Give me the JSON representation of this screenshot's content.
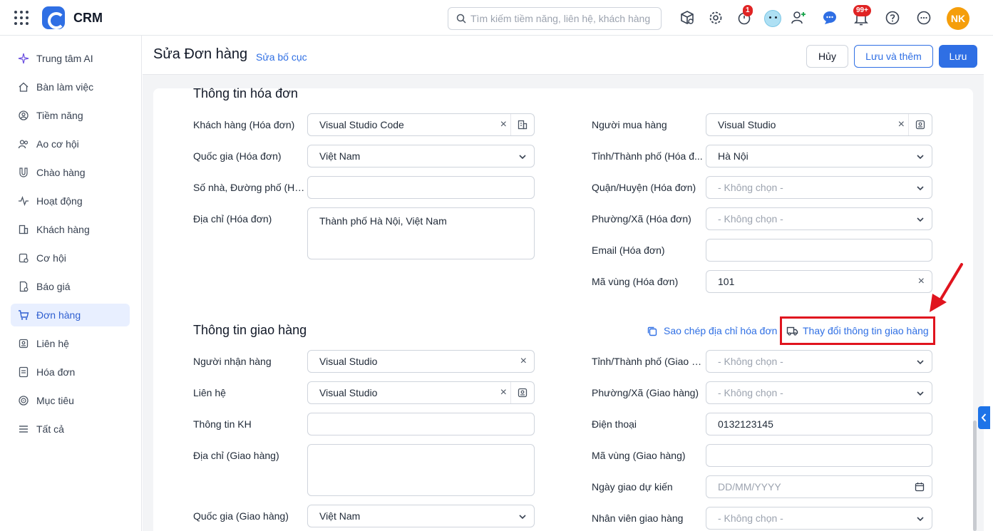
{
  "app": {
    "name": "CRM"
  },
  "search": {
    "placeholder": "Tìm kiếm tiềm năng, liên hệ, khách hàng"
  },
  "topbar": {
    "badge_timer": "1",
    "badge_bell": "99+",
    "avatar_initials": "NK"
  },
  "sidebar": {
    "items": [
      {
        "label": "Trung tâm AI",
        "icon": "sparkle-icon"
      },
      {
        "label": "Bàn làm việc",
        "icon": "home-icon"
      },
      {
        "label": "Tiềm năng",
        "icon": "target-user-icon"
      },
      {
        "label": "Ao cơ hội",
        "icon": "users-icon"
      },
      {
        "label": "Chào hàng",
        "icon": "magnet-icon"
      },
      {
        "label": "Hoạt động",
        "icon": "activity-icon"
      },
      {
        "label": "Khách hàng",
        "icon": "building-icon"
      },
      {
        "label": "Cơ hội",
        "icon": "opportunity-icon"
      },
      {
        "label": "Báo giá",
        "icon": "quote-icon"
      },
      {
        "label": "Đơn hàng",
        "icon": "cart-icon"
      },
      {
        "label": "Liên hệ",
        "icon": "contact-icon"
      },
      {
        "label": "Hóa đơn",
        "icon": "invoice-icon"
      },
      {
        "label": "Mục tiêu",
        "icon": "goal-icon"
      },
      {
        "label": "Tất cả",
        "icon": "menu-icon"
      }
    ],
    "active_index": 9
  },
  "page": {
    "title": "Sửa Đơn hàng",
    "edit_layout": "Sửa bố cục"
  },
  "actions": {
    "cancel": "Hủy",
    "save_add": "Lưu và thêm",
    "save": "Lưu"
  },
  "billing": {
    "title": "Thông tin hóa đơn",
    "customer_label": "Khách hàng (Hóa đơn)",
    "customer_value": "Visual Studio Code",
    "country_label": "Quốc gia (Hóa đơn)",
    "country_value": "Việt Nam",
    "street_label": "Số nhà, Đường phố (Hó...",
    "address_label": "Địa chỉ (Hóa đơn)",
    "address_value": "Thành phố Hà Nội, Việt Nam",
    "buyer_label": "Người mua hàng",
    "buyer_value": "Visual Studio",
    "province_label": "Tỉnh/Thành phố (Hóa đ...",
    "province_value": "Hà Nội",
    "district_label": "Quận/Huyện (Hóa đơn)",
    "district_value": "- Không chọn -",
    "ward_label": "Phường/Xã (Hóa đơn)",
    "ward_value": "- Không chọn -",
    "email_label": "Email (Hóa đơn)",
    "area_label": "Mã vùng (Hóa đơn)",
    "area_value": "101"
  },
  "shipping": {
    "title": "Thông tin giao hàng",
    "copy_link": "Sao chép địa chỉ hóa đơn",
    "change_link": "Thay đổi thông tin giao hàng",
    "receiver_label": "Người nhận hàng",
    "receiver_value": "Visual Studio",
    "contact_label": "Liên hệ",
    "contact_value": "Visual Studio",
    "custinfo_label": "Thông tin KH",
    "address_label": "Địa chỉ (Giao hàng)",
    "country_label": "Quốc gia (Giao hàng)",
    "country_value": "Việt Nam",
    "province_label": "Tỉnh/Thành phố (Giao h...",
    "province_value": "- Không chọn -",
    "ward_label": "Phường/Xã (Giao hàng)",
    "ward_value": "- Không chọn -",
    "phone_label": "Điện thoại",
    "phone_value": "0132123145",
    "area_label": "Mã vùng (Giao hàng)",
    "date_label": "Ngày giao dự kiến",
    "date_placeholder": "DD/MM/YYYY",
    "staff_label": "Nhân viên giao hàng",
    "staff_value": "- Không chọn -"
  },
  "accent": "#2f6fe4",
  "highlight": "#e0141e"
}
